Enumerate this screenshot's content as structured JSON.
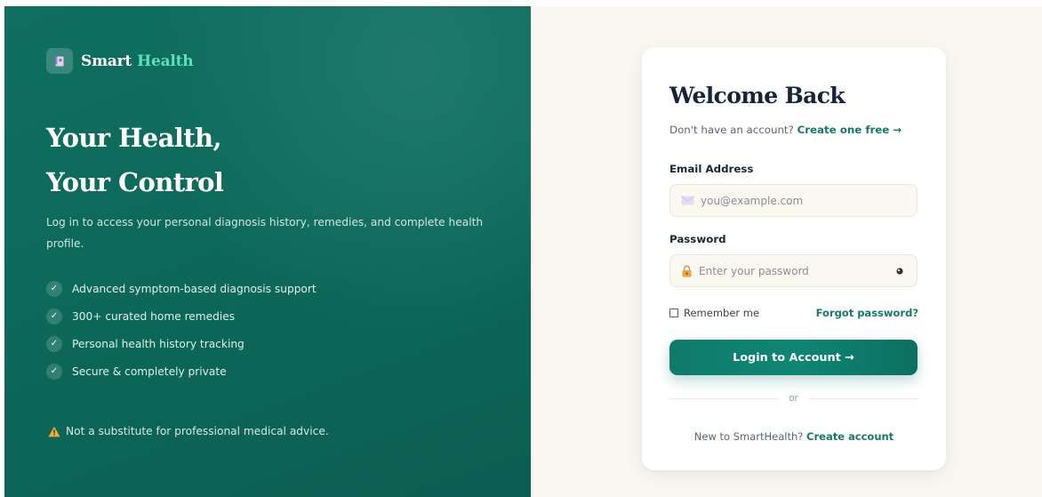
{
  "brand": {
    "name_part1": "Smart",
    "name_part2": "Health",
    "logo_icon": "medical-book-icon"
  },
  "hero": {
    "title_line1": "Your Health,",
    "title_line2": "Your Control",
    "subtitle": "Log in to access your personal diagnosis history, remedies, and complete health profile.",
    "features": [
      {
        "icon": "check-icon",
        "label": "Advanced symptom-based diagnosis support"
      },
      {
        "icon": "check-icon",
        "label": "300+ curated home remedies"
      },
      {
        "icon": "check-icon",
        "label": "Personal health history tracking"
      },
      {
        "icon": "check-icon",
        "label": "Secure & completely private"
      }
    ],
    "check_glyph": "✓",
    "disclaimer": "Not a substitute for professional medical advice.",
    "disclaimer_icon": "warning-icon"
  },
  "login": {
    "title": "Welcome Back",
    "no_account_text": "Don't have an account?",
    "create_link": "Create one free →",
    "email_label": "Email Address",
    "email_placeholder": "you@example.com",
    "email_icon": "envelope-icon",
    "password_label": "Password",
    "password_placeholder": "Enter your password",
    "password_icon": "lock-icon",
    "show_password_icon": "eye-icon",
    "remember_label": "Remember me",
    "remember_checked": false,
    "forgot_link": "Forgot password?",
    "submit_label": "Login to Account →",
    "divider_text": "or",
    "new_user_text": "New to SmartHealth?",
    "create_account_link": "Create account"
  },
  "colors": {
    "hero_green": "#0d6a5b",
    "accent_mint": "#5ee0b8",
    "link_teal": "#137a6a",
    "panel_cream": "#faf7f2",
    "title_navy": "#16233b"
  }
}
